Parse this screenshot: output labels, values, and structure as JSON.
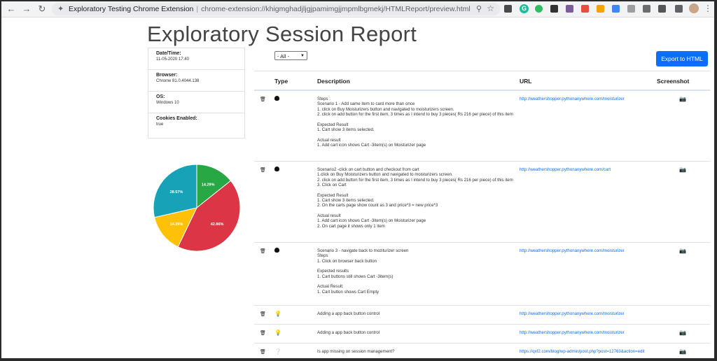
{
  "browser": {
    "tab_title": "Exploratory Testing Chrome Extension",
    "url": "chrome-extension://khigmghadjljgjpamimgjjmpmlbgmekj/HTMLReport/preview.html"
  },
  "page": {
    "title": "Exploratory Session Report",
    "info": [
      {
        "label": "Date/Time:",
        "value": "11-05-2020 17:40"
      },
      {
        "label": "Browser:",
        "value": "Chrome 81.0.4044.138"
      },
      {
        "label": "OS:",
        "value": "Windows 10"
      },
      {
        "label": "Cookies Enabled:",
        "value": "true"
      }
    ],
    "filter": {
      "selected": "- All -"
    },
    "export_label": "Export to HTML",
    "table": {
      "headers": {
        "type": "Type",
        "description": "Description",
        "url": "URL",
        "screenshot": "Screenshot"
      },
      "rows": [
        {
          "type_icon": "bug-icon",
          "description": "Steps :\nScenario 1 - Add same item to card more than once\n1. click on Buy Moisturizers button and navigated to moisturizers screen.\n2. click on add button for the first item, 3 times as I intend to buy 3 pieces( Rs 216 per piece) of this item\n\nExpected Result\n1. Cart show 3 items selected.\n\nActual result\n1. Add cart icon shows Cart -3item(s) on Moisturizer page",
          "url": "http://weathershopper.pythonanywhere.com/moisturizer",
          "has_screenshot": true
        },
        {
          "type_icon": "bug-icon",
          "description": "Scenario2 -click on cart button and checkout from cart\n1.click on Buy Moisturizers button and navigated to moisturizers screen.\n2. click on add button for the first item, 3 times as I intend to buy 3 pieces( Rs 216 per piece) of this item\n3. Click on Cart\n\nExpected Result\n1. Cart show 3 items selected.\n2. On the carts page show count as 3 and price*3 = new price*3\n\nActual result\n1. Add cart icon shows Cart -3item(s) on Moisturizer page\n2. On cart page it shows only 1 item",
          "url": "http://weathershopper.pythonanywhere.com/cart",
          "has_screenshot": true
        },
        {
          "type_icon": "bug-icon",
          "description": "Scenario 3  - navigate back to moziturizer screen\nSteps\n1. Click on browser back button\n\nExpected results\n1. Cart buttons still shows Cart -3item(s)\n\nActual Result:\n1. Cart button shows Cart Empty",
          "url": "http://weathershopper.pythonanywhere.com/moisturizer",
          "has_screenshot": true
        },
        {
          "type_icon": "idea-icon",
          "description": "Adding a app back button control",
          "url": "http://weathershopper.pythonanywhere.com/moisturizer",
          "has_screenshot": false
        },
        {
          "type_icon": "idea-icon",
          "description": "Adding a app back button control",
          "url": "http://weathershopper.pythonanywhere.com/moisturizer",
          "has_screenshot": true
        },
        {
          "type_icon": "question-icon",
          "description": "Is app  missing on session management?",
          "url": "https://qxf2.com/blog/wp-admin/post.php?post=12763&action=edit",
          "has_screenshot": true
        }
      ]
    },
    "pie": {
      "slices": [
        {
          "label": "14.29%",
          "value": 14.29,
          "color": "#28a745"
        },
        {
          "label": "42.86%",
          "value": 42.86,
          "color": "#dc3545"
        },
        {
          "label": "14.29%",
          "value": 14.29,
          "color": "#ffc107"
        },
        {
          "label": "28.57%",
          "value": 28.57,
          "color": "#17a2b8"
        }
      ]
    }
  }
}
